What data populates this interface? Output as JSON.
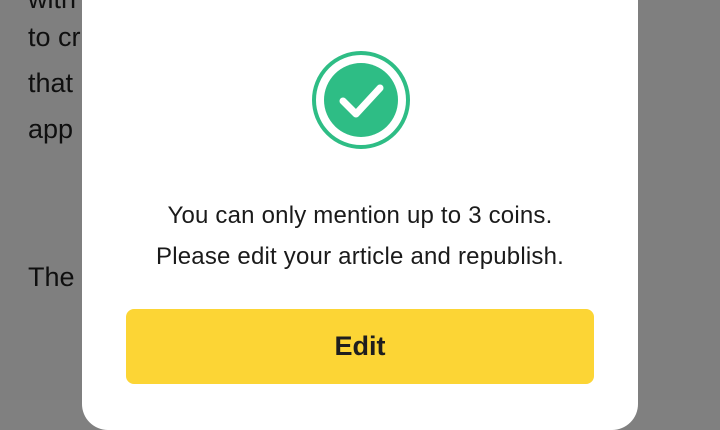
{
  "article": {
    "lines": [
      "with",
      "to cr",
      "that",
      "app",
      "The"
    ]
  },
  "modal": {
    "icon": "check-circle-icon",
    "message_line1": "You can only mention up to 3 coins.",
    "message_line2": "Please edit your article and republish.",
    "edit_label": "Edit",
    "colors": {
      "accent": "#2ebd85",
      "button": "#fcd535"
    }
  }
}
